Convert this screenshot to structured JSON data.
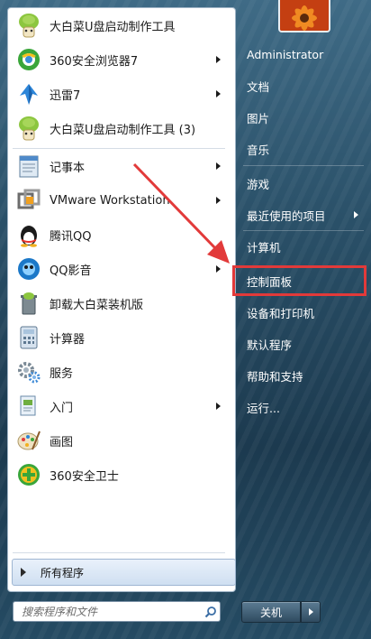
{
  "pinned_programs": [
    {
      "label": "大白菜U盘启动制作工具",
      "icon": "dabaicai-icon",
      "has_submenu": false
    },
    {
      "label": "360安全浏览器7",
      "icon": "360-browser-icon",
      "has_submenu": true
    },
    {
      "label": "迅雷7",
      "icon": "xunlei-icon",
      "has_submenu": true
    },
    {
      "label": "大白菜U盘启动制作工具 (3)",
      "icon": "dabaicai-icon",
      "has_submenu": false
    }
  ],
  "recent_programs": [
    {
      "label": "记事本",
      "icon": "notepad-icon",
      "has_submenu": true
    },
    {
      "label": "VMware Workstation",
      "icon": "vmware-icon",
      "has_submenu": true
    },
    {
      "label": "腾讯QQ",
      "icon": "qq-icon",
      "has_submenu": false
    },
    {
      "label": "QQ影音",
      "icon": "qq-player-icon",
      "has_submenu": true
    },
    {
      "label": "卸载大白菜装机版",
      "icon": "uninstall-icon",
      "has_submenu": false
    },
    {
      "label": "计算器",
      "icon": "calculator-icon",
      "has_submenu": false
    },
    {
      "label": "服务",
      "icon": "services-gear-icon",
      "has_submenu": false
    },
    {
      "label": "入门",
      "icon": "getting-started-icon",
      "has_submenu": true
    },
    {
      "label": "画图",
      "icon": "paint-icon",
      "has_submenu": false
    },
    {
      "label": "360安全卫士",
      "icon": "360-safe-icon",
      "has_submenu": false
    }
  ],
  "all_programs_label": "所有程序",
  "search": {
    "placeholder": "搜索程序和文件"
  },
  "right_links": [
    {
      "label": "Administrator",
      "has_submenu": false
    },
    {
      "label": "文档",
      "has_submenu": false
    },
    {
      "label": "图片",
      "has_submenu": false
    },
    {
      "label": "音乐",
      "has_submenu": false
    },
    {
      "label": "游戏",
      "has_submenu": false
    },
    {
      "label": "最近使用的项目",
      "has_submenu": true
    },
    {
      "label": "计算机",
      "has_submenu": false
    },
    {
      "label": "控制面板",
      "has_submenu": false
    },
    {
      "label": "设备和打印机",
      "has_submenu": false
    },
    {
      "label": "默认程序",
      "has_submenu": false
    },
    {
      "label": "帮助和支持",
      "has_submenu": false
    },
    {
      "label": "运行...",
      "has_submenu": false
    }
  ],
  "highlighted_item": "控制面板",
  "shutdown_label": "关机",
  "colors": {
    "highlight": "#e23a3a",
    "menu_glass": "#2a5068"
  }
}
